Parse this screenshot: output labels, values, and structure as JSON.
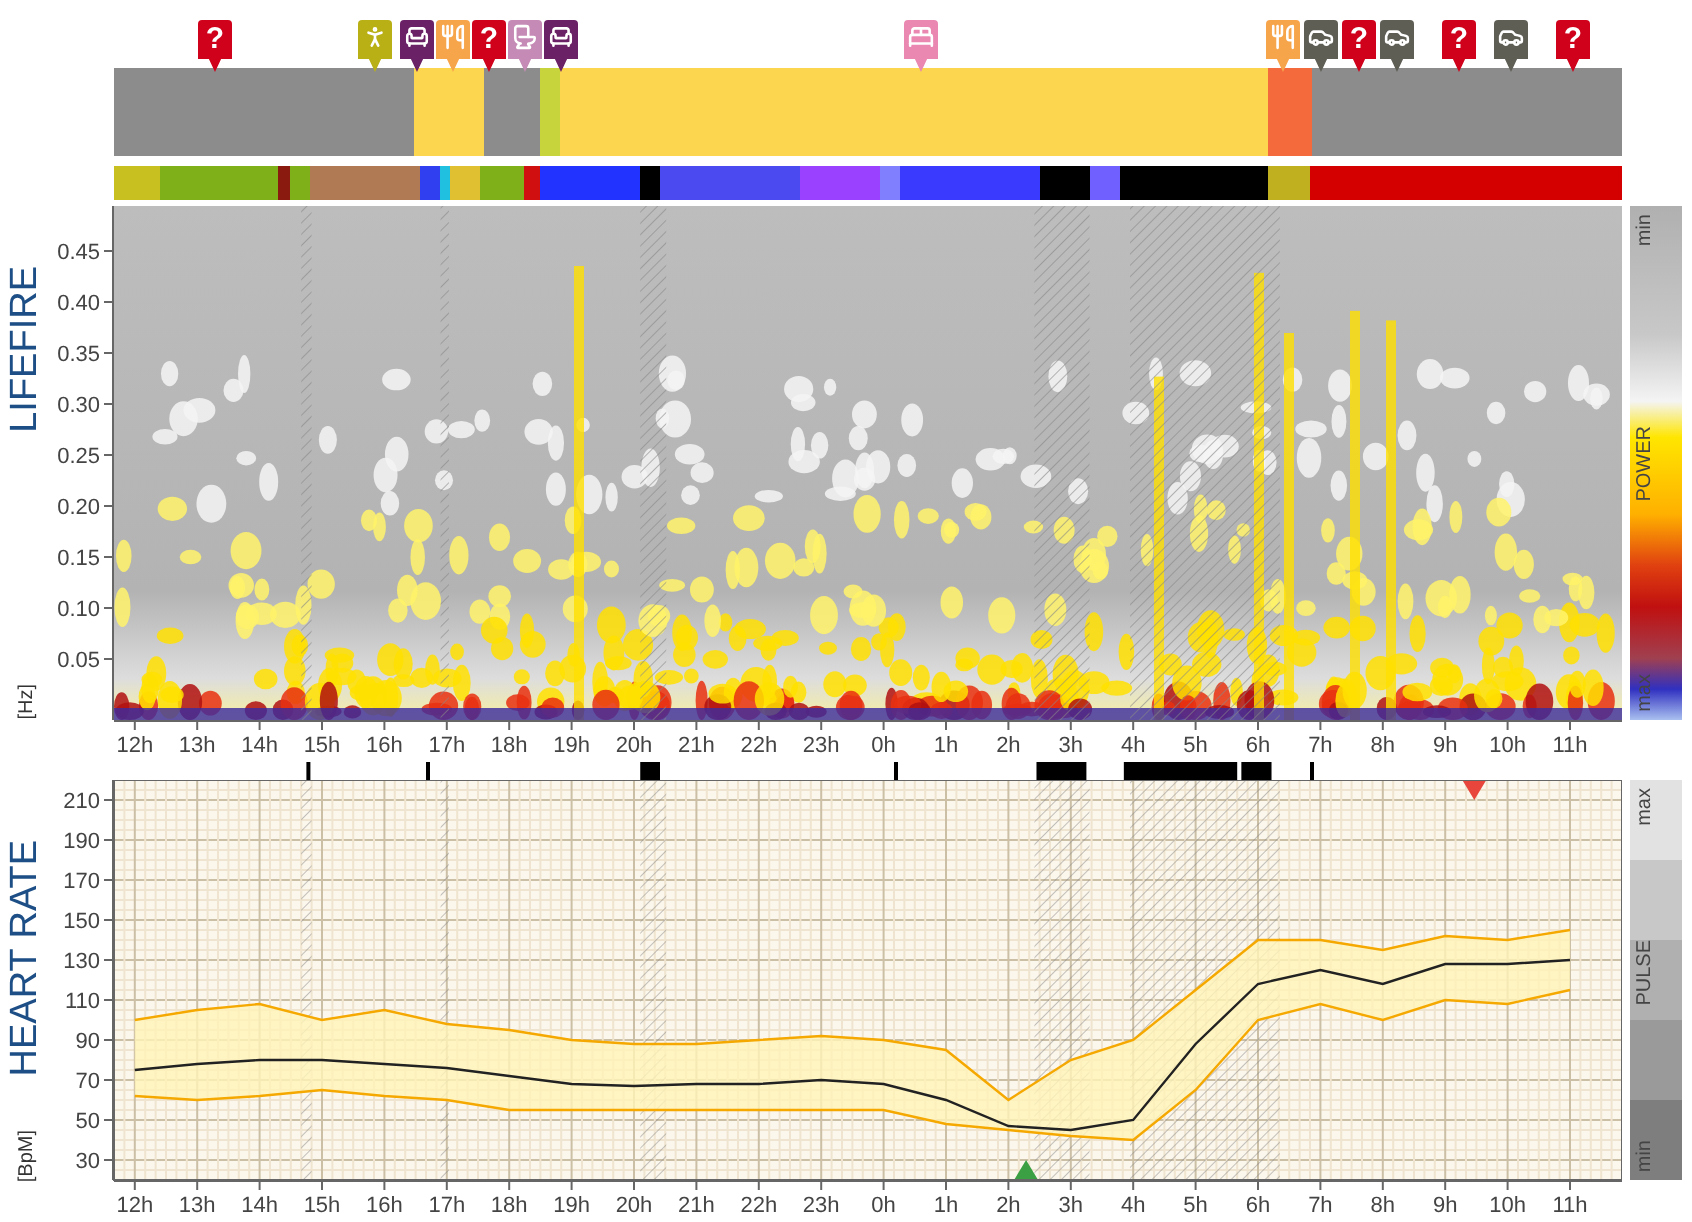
{
  "activity": {
    "pins": [
      {
        "kind": "unknown",
        "label": "?",
        "color": "#d0021b"
      },
      {
        "kind": "walking",
        "color": "#b8b015"
      },
      {
        "kind": "recline",
        "color": "#6b2166"
      },
      {
        "kind": "eating",
        "color": "#f7a54b"
      },
      {
        "kind": "unknown",
        "label": "?",
        "color": "#d0021b"
      },
      {
        "kind": "toilet",
        "color": "#c58ab5"
      },
      {
        "kind": "recline",
        "color": "#6b2166"
      },
      {
        "kind": "bed",
        "color": "#ea88b2"
      },
      {
        "kind": "eating",
        "color": "#f7a54b"
      },
      {
        "kind": "car",
        "color": "#5e5e55"
      },
      {
        "kind": "unknown",
        "label": "?",
        "color": "#d0021b"
      },
      {
        "kind": "car",
        "color": "#5e5e55"
      },
      {
        "kind": "unknown",
        "label": "?",
        "color": "#d0021b"
      },
      {
        "kind": "car",
        "color": "#5e5e55"
      },
      {
        "kind": "unknown",
        "label": "?",
        "color": "#d0021b"
      }
    ]
  },
  "hours": [
    "12h",
    "13h",
    "14h",
    "15h",
    "16h",
    "17h",
    "18h",
    "19h",
    "20h",
    "21h",
    "22h",
    "23h",
    "0h",
    "1h",
    "2h",
    "3h",
    "4h",
    "5h",
    "6h",
    "7h",
    "8h",
    "9h",
    "10h",
    "11h"
  ],
  "lifefire": {
    "title": "LIFEFIRE",
    "unit": "[Hz]",
    "yticks": [
      "0.45",
      "0.40",
      "0.35",
      "0.30",
      "0.25",
      "0.20",
      "0.15",
      "0.10",
      "0.05"
    ],
    "legend": {
      "top": "min",
      "label": "POWER",
      "bottom": "max"
    }
  },
  "heart_rate": {
    "title": "HEART RATE",
    "unit": "[BpM]",
    "legend": {
      "top": "max",
      "label": "PULSE",
      "bottom": "min"
    },
    "markers": [
      {
        "kind": "low",
        "color": "#3aa043"
      },
      {
        "kind": "high",
        "color": "#e8463c"
      }
    ],
    "chart_data": {
      "type": "line",
      "grid": true,
      "categories": [
        "12h",
        "13h",
        "14h",
        "15h",
        "16h",
        "17h",
        "18h",
        "19h",
        "20h",
        "21h",
        "22h",
        "23h",
        "0h",
        "1h",
        "2h",
        "3h",
        "4h",
        "5h",
        "6h",
        "7h",
        "8h",
        "9h",
        "10h",
        "11h"
      ],
      "ylim": [
        20,
        220
      ],
      "yticks": [
        30,
        50,
        70,
        90,
        110,
        130,
        150,
        170,
        190,
        210
      ],
      "series": [
        {
          "color": "#f5a800",
          "values": [
            100,
            105,
            108,
            100,
            105,
            98,
            95,
            90,
            88,
            88,
            90,
            92,
            90,
            85,
            60,
            80,
            90,
            115,
            140,
            140,
            135,
            142,
            140,
            145
          ]
        },
        {
          "color": "#222222",
          "values": [
            75,
            78,
            80,
            80,
            78,
            76,
            72,
            68,
            67,
            68,
            68,
            70,
            68,
            60,
            47,
            45,
            50,
            88,
            118,
            125,
            118,
            128,
            128,
            130
          ]
        },
        {
          "color": "#f5a800",
          "values": [
            62,
            60,
            62,
            65,
            62,
            60,
            55,
            55,
            55,
            55,
            55,
            55,
            55,
            48,
            45,
            42,
            40,
            65,
            100,
            108,
            100,
            110,
            108,
            115
          ]
        }
      ]
    }
  }
}
